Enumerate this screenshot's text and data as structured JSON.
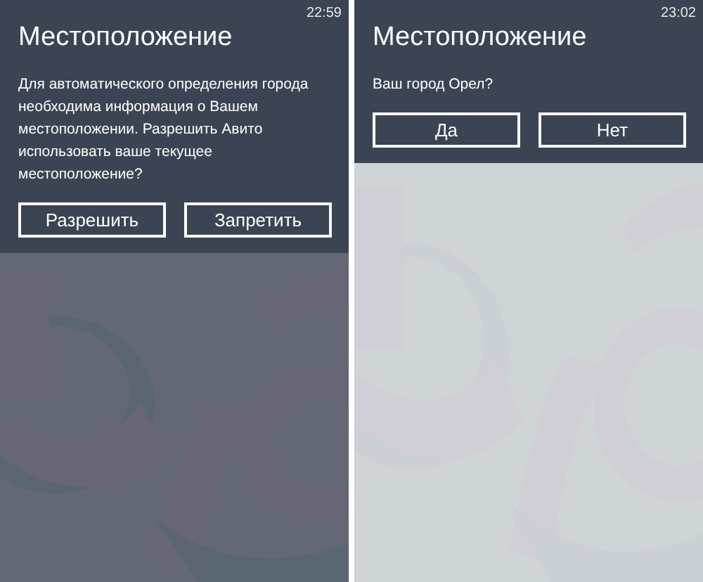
{
  "screens": [
    {
      "time": "22:59",
      "title": "Местоположение",
      "message": "Для автоматического определения города необходима информация о Вашем местоположении. Разрешить Авито использовать ваше текущее местоположение?",
      "buttons": [
        "Разрешить",
        "Запретить"
      ],
      "dimmed": true
    },
    {
      "time": "23:02",
      "title": "Местоположение",
      "message": "Ваш город Орел?",
      "buttons": [
        "Да",
        "Нет"
      ],
      "dimmed": false
    }
  ]
}
